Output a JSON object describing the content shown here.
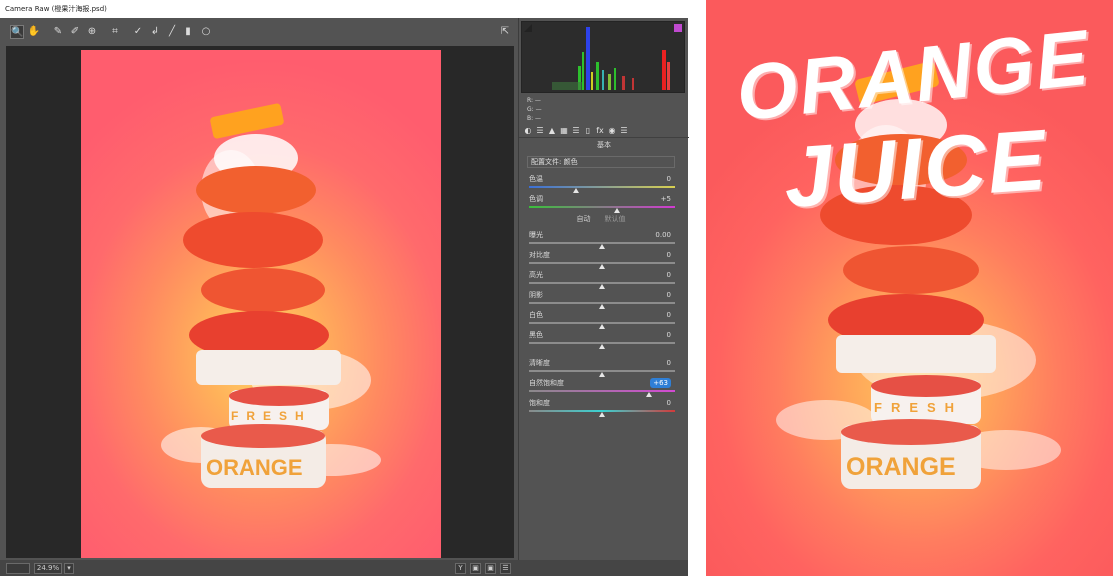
{
  "window": {
    "title": "Camera Raw (橙果汁海报.psd)"
  },
  "toolbar": {
    "tools": [
      {
        "icon": "zoom-icon",
        "glyph": "🔍"
      },
      {
        "icon": "hand-icon",
        "glyph": "✋"
      },
      {
        "icon": "white-balance-icon",
        "glyph": "✎"
      },
      {
        "icon": "color-sampler-icon",
        "glyph": "✐"
      },
      {
        "icon": "targeted-adjust-icon",
        "glyph": "⊕"
      },
      {
        "icon": "crop-icon",
        "glyph": "⌗"
      },
      {
        "icon": "spot-removal-icon",
        "glyph": "✓"
      },
      {
        "icon": "red-eye-icon",
        "glyph": "↲"
      },
      {
        "icon": "adjustment-brush-icon",
        "glyph": "╱"
      },
      {
        "icon": "graduated-filter-icon",
        "glyph": "▮"
      },
      {
        "icon": "radial-filter-icon",
        "glyph": "○"
      }
    ],
    "open-prefs-glyph": "⇱"
  },
  "histogram": {
    "readout": [
      "R: —",
      "G: —",
      "B: —"
    ]
  },
  "panel": {
    "section_title": "基本",
    "profile_label": "配置文件: 颜色",
    "tabs": [
      "◐",
      "☰",
      "▲",
      "▦",
      "☰",
      "▯",
      "fx",
      "◉",
      "☰"
    ],
    "auto_label": "自动",
    "default_label": "默认值",
    "sliders": [
      {
        "label": "色温",
        "value": "0",
        "pos": 0.32,
        "track": "temp"
      },
      {
        "label": "色调",
        "value": "+5",
        "pos": 0.6,
        "track": "tint"
      },
      {
        "label": "曝光",
        "value": "0.00",
        "pos": 0.5,
        "track": "gray"
      },
      {
        "label": "对比度",
        "value": "0",
        "pos": 0.5,
        "track": "gray"
      },
      {
        "label": "高光",
        "value": "0",
        "pos": 0.5,
        "track": "gray"
      },
      {
        "label": "阴影",
        "value": "0",
        "pos": 0.5,
        "track": "gray"
      },
      {
        "label": "白色",
        "value": "0",
        "pos": 0.5,
        "track": "gray"
      },
      {
        "label": "黑色",
        "value": "0",
        "pos": 0.5,
        "track": "gray"
      },
      {
        "label": "清晰度",
        "value": "0",
        "pos": 0.5,
        "track": "gray"
      },
      {
        "label": "自然饱和度",
        "value": "+63",
        "pos": 0.82,
        "track": "vib",
        "highlight": true
      },
      {
        "label": "饱和度",
        "value": "0",
        "pos": 0.5,
        "track": "sat"
      }
    ]
  },
  "status": {
    "zoom": "24.9%",
    "zoom_menu_glyph": "▾",
    "right_icons": [
      "Y",
      "▣",
      "▣",
      "☰"
    ]
  },
  "poster": {
    "line1": "ORANGE",
    "line2": "JUICE",
    "bottle_text": "ORANGE",
    "band_text": "FRESH"
  },
  "colors": {
    "panel_bg": "#535353",
    "canvas_bg": "#282828",
    "accent": "#2f7fd6"
  }
}
